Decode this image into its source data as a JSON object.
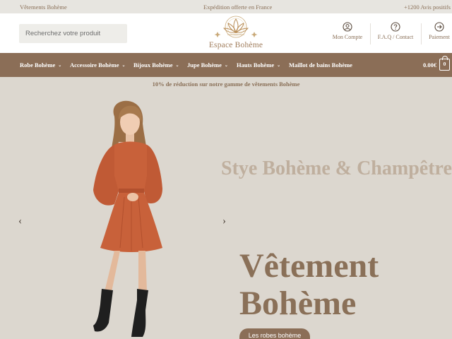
{
  "topbar": {
    "left": "Vêtements Bohème",
    "center": "Expédition offerte en France",
    "right": "+1200 Avis positifs"
  },
  "search": {
    "placeholder": "Recherchez votre produit"
  },
  "logo": {
    "text": "Espace Bohème"
  },
  "header_links": {
    "account": "Mon Compte",
    "faq": "F.A.Q / Contact",
    "payment": "Paiement"
  },
  "nav": {
    "items": [
      {
        "label": "Robe Bohème",
        "has_dropdown": true
      },
      {
        "label": "Accessoire Bohème",
        "has_dropdown": true
      },
      {
        "label": "Bijoux Bohème",
        "has_dropdown": true
      },
      {
        "label": "Jupe Bohème",
        "has_dropdown": true
      },
      {
        "label": "Hauts Bohème",
        "has_dropdown": true
      },
      {
        "label": "Maillot de bains Bohème",
        "has_dropdown": false
      }
    ],
    "cart_total": "0.00€",
    "cart_count": "0"
  },
  "promo": {
    "text": "10% de réduction sur notre gamme de vêtements Bohème"
  },
  "hero": {
    "subtitle": "Stye Bohème & Champêtre",
    "title_line1": "Vêtement",
    "title_line2": "Bohème",
    "cta": "Les robes bohème",
    "prev_arrow": "‹",
    "next_arrow": "›"
  },
  "colors": {
    "brand_brown": "#8b6e57",
    "text_brown": "#8a7058",
    "hero_bg": "#dcd7cf",
    "dress": "#c8613a"
  }
}
